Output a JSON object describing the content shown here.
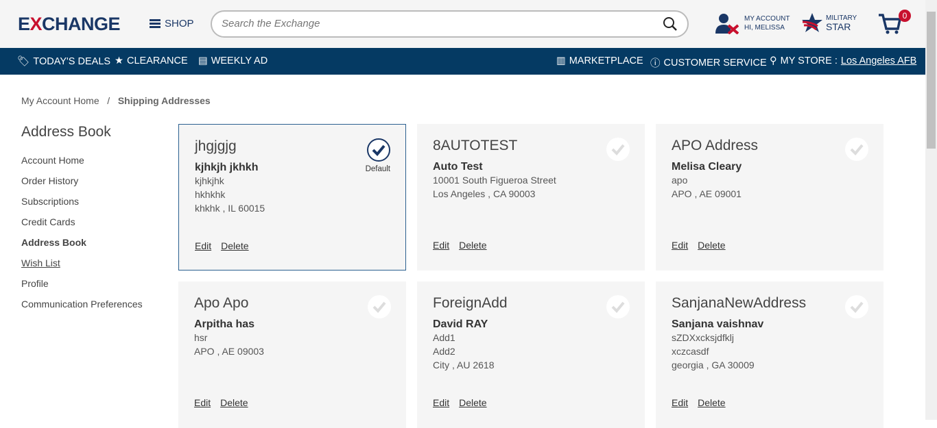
{
  "header": {
    "logo": "EXCHANGE",
    "shop_label": "SHOP",
    "search_placeholder": "Search the Exchange",
    "account_label": "MY ACCOUNT",
    "account_greeting": "HI, MELISSA",
    "military_line1": "MILITARY",
    "military_line2": "STAR",
    "cart_count": "0"
  },
  "nav": {
    "todays_deals": "TODAY'S DEALS",
    "clearance": "CLEARANCE",
    "weekly_ad": "WEEKLY AD",
    "marketplace": "MARKETPLACE",
    "customer_service": "CUSTOMER SERVICE",
    "my_store_label": "MY STORE :",
    "my_store_value": "Los Angeles AFB"
  },
  "breadcrumb": {
    "home": "My Account Home",
    "sep": "/",
    "current": "Shipping Addresses"
  },
  "sidebar": {
    "title": "Address Book",
    "items": [
      {
        "label": "Account Home"
      },
      {
        "label": "Order History"
      },
      {
        "label": "Subscriptions"
      },
      {
        "label": "Credit Cards"
      },
      {
        "label": "Address Book",
        "active": true
      },
      {
        "label": "Wish List"
      },
      {
        "label": "Profile"
      },
      {
        "label": "Communication Preferences"
      }
    ]
  },
  "colors": {
    "brand": "#1a3766",
    "nav_bg": "#053a63",
    "accent_red": "#c8102e"
  },
  "cards": {
    "edit_label": "Edit",
    "delete_label": "Delete",
    "default_label": "Default",
    "items": [
      {
        "nickname": "jhgjgjg",
        "name": "kjhkjh jkhkh",
        "lines": [
          "kjhkjhk",
          "hkhkhk",
          "khkhk ,  IL   60015"
        ],
        "default": true
      },
      {
        "nickname": "8AUTOTEST",
        "name": "Auto Test",
        "lines": [
          "10001 South Figueroa Street",
          "Los Angeles ,  CA   90003"
        ]
      },
      {
        "nickname": "APO Address",
        "name": "Melisa Cleary",
        "lines": [
          "apo",
          "APO ,  AE   09001"
        ]
      },
      {
        "nickname": "Apo Apo",
        "name": "Arpitha has",
        "lines": [
          "hsr",
          "APO ,  AE   09003"
        ]
      },
      {
        "nickname": "ForeignAdd",
        "name": "David RAY",
        "lines": [
          "Add1",
          "Add2",
          "City ,  AU   2618"
        ]
      },
      {
        "nickname": "SanjanaNewAddress",
        "name": "Sanjana vaishnav",
        "lines": [
          "sZDXxcksjdfklj",
          "xczcasdf",
          "georgia ,  GA   30009"
        ]
      }
    ]
  }
}
